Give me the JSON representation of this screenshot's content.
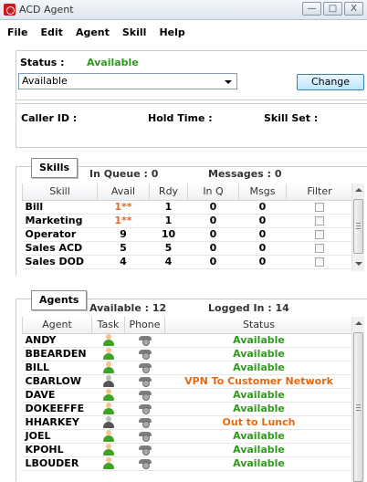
{
  "window": {
    "title": "ACD Agent",
    "buttons": [
      "—",
      "□",
      "X"
    ]
  },
  "menu": [
    "File",
    "Edit",
    "Agent",
    "Skill",
    "Help"
  ],
  "status": {
    "label": "Status :",
    "value": "Available",
    "selected": "Available",
    "change_label": "Change"
  },
  "caller": {
    "caller_id_label": "Caller ID :",
    "hold_time_label": "Hold Time :",
    "skill_set_label": "Skill Set :"
  },
  "skills": {
    "tab_label": "Skills",
    "in_queue": "In Queue : 0",
    "messages": "Messages : 0",
    "columns": [
      "Skill",
      "Avail",
      "Rdy",
      "In Q",
      "Msgs",
      "Filter"
    ],
    "rows": [
      {
        "skill": "Bill",
        "avail": "1**",
        "rdy": "1",
        "inq": "0",
        "msgs": "0",
        "filter": false
      },
      {
        "skill": "Marketing",
        "avail": "1**",
        "rdy": "1",
        "inq": "0",
        "msgs": "0",
        "filter": false
      },
      {
        "skill": "Operator",
        "avail": "9",
        "rdy": "10",
        "inq": "0",
        "msgs": "0",
        "filter": false
      },
      {
        "skill": "Sales ACD",
        "avail": "5",
        "rdy": "5",
        "inq": "0",
        "msgs": "0",
        "filter": false
      },
      {
        "skill": "Sales DOD",
        "avail": "4",
        "rdy": "4",
        "inq": "0",
        "msgs": "0",
        "filter": false
      }
    ]
  },
  "agents": {
    "tab_label": "Agents",
    "available": "Available : 12",
    "logged_in": "Logged In : 14",
    "columns": [
      "Agent",
      "Task",
      "Phone",
      "Status"
    ],
    "rows": [
      {
        "agent": "ANDY",
        "task_icon": "person-green-icon",
        "status": "Available"
      },
      {
        "agent": "BBEARDEN",
        "task_icon": "person-green-icon",
        "status": "Available"
      },
      {
        "agent": "BILL",
        "task_icon": "person-green-icon",
        "status": "Available"
      },
      {
        "agent": "CBARLOW",
        "task_icon": "person-dark-icon",
        "status": "VPN To Customer Network"
      },
      {
        "agent": "DAVE",
        "task_icon": "person-green-icon",
        "status": "Available"
      },
      {
        "agent": "DOKEEFFE",
        "task_icon": "person-green-icon",
        "status": "Available"
      },
      {
        "agent": "HHARKEY",
        "task_icon": "person-dark-icon",
        "status": "Out to Lunch"
      },
      {
        "agent": "JOEL",
        "task_icon": "person-green-icon",
        "status": "Available"
      },
      {
        "agent": "KPOHL",
        "task_icon": "person-green-icon",
        "status": "Available"
      },
      {
        "agent": "LBOUDER",
        "task_icon": "person-green-icon",
        "status": "Available"
      }
    ]
  },
  "colors": {
    "available_green": "#2f9a1c",
    "away_orange": "#e26a12",
    "avail_star_orange": "#e8671d"
  }
}
